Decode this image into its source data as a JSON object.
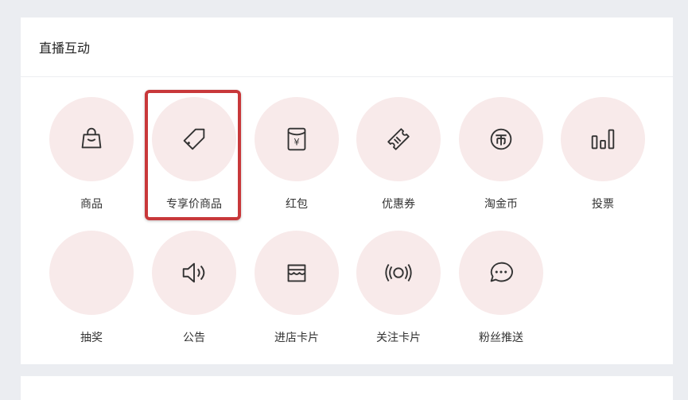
{
  "section": {
    "title": "直播互动"
  },
  "tools": [
    {
      "label": "商品",
      "icon": "shopping-bag-icon"
    },
    {
      "label": "专享价商品",
      "icon": "price-tag-icon"
    },
    {
      "label": "红包",
      "icon": "red-envelope-icon"
    },
    {
      "label": "优惠券",
      "icon": "coupon-icon"
    },
    {
      "label": "淘金币",
      "icon": "coin-icon"
    },
    {
      "label": "投票",
      "icon": "bar-chart-icon"
    },
    {
      "label": "抽奖",
      "icon": ""
    },
    {
      "label": "公告",
      "icon": "speaker-icon"
    },
    {
      "label": "进店卡片",
      "icon": "storefront-icon"
    },
    {
      "label": "关注卡片",
      "icon": "broadcast-icon"
    },
    {
      "label": "粉丝推送",
      "icon": "chat-bubble-icon"
    }
  ],
  "colors": {
    "tile_bg": "#f8eaea",
    "highlight_border": "#c8383a",
    "page_bg": "#ebedf1"
  }
}
